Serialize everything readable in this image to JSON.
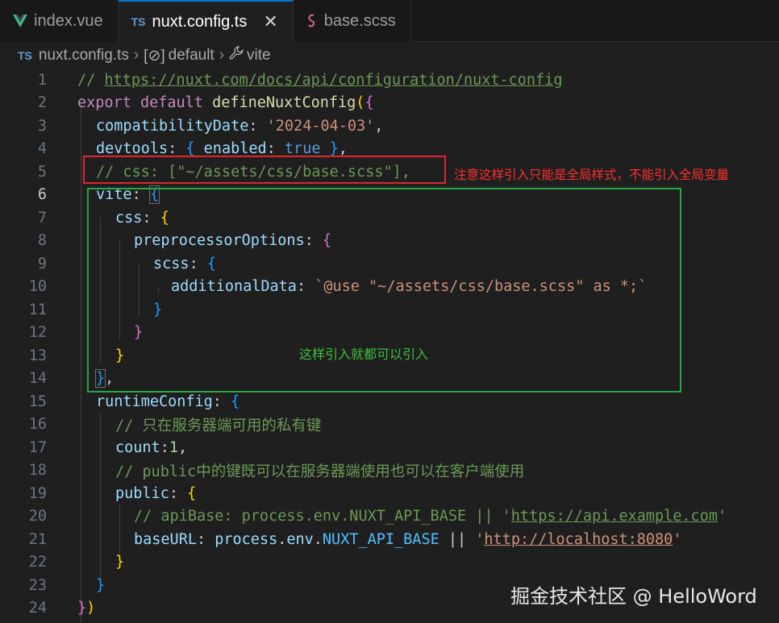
{
  "tabs": [
    {
      "label": "index.vue",
      "icon": "vue-icon"
    },
    {
      "label": "nuxt.config.ts",
      "icon": "typescript-icon",
      "prefix": "TS",
      "active": true,
      "close": "✕"
    },
    {
      "label": "base.scss",
      "icon": "scss-icon"
    }
  ],
  "breadcrumb": {
    "prefix": "TS",
    "file": "nuxt.config.ts",
    "sep": "›",
    "symbol": "default",
    "symbol_icon": "[⊘]",
    "last": "vite"
  },
  "line_numbers": [
    "1",
    "2",
    "3",
    "4",
    "5",
    "6",
    "7",
    "8",
    "9",
    "10",
    "11",
    "12",
    "13",
    "14",
    "15",
    "16",
    "17",
    "18",
    "19",
    "20",
    "21",
    "22",
    "23",
    "24"
  ],
  "code": {
    "l1": {
      "comment": "// ",
      "url": "https://nuxt.com/docs/api/configuration/nuxt-config"
    },
    "l2": {
      "kw1": "export",
      "kw2": "default",
      "fn": "defineNuxtConfig",
      "open": "(",
      "brace": "{"
    },
    "l3": {
      "prop": "compatibilityDate",
      "colon": ": ",
      "str": "'2024-04-03'",
      "comma": ","
    },
    "l4": {
      "prop": "devtools",
      "colon": ": ",
      "ob": "{",
      "prop2": " enabled",
      "colon2": ": ",
      "val": "true",
      "cb": " }",
      "comma": ","
    },
    "l5": {
      "comment": "// css: [\"~/assets/css/base.scss\"],"
    },
    "l6": {
      "prop": "vite",
      "colon": ": ",
      "brace": "{"
    },
    "l7": {
      "prop": "css",
      "colon": ": ",
      "brace": "{"
    },
    "l8": {
      "prop": "preprocessorOptions",
      "colon": ": ",
      "brace": "{"
    },
    "l9": {
      "prop": "scss",
      "colon": ": ",
      "brace": "{"
    },
    "l10": {
      "prop": "additionalData",
      "colon": ": ",
      "str": "`@use \"~/assets/css/base.scss\" as *;`"
    },
    "l11": {
      "brace": "}"
    },
    "l12": {
      "brace": "}"
    },
    "l13": {
      "brace": "}"
    },
    "l14": {
      "brace": "}",
      "comma": ","
    },
    "l15": {
      "prop": "runtimeConfig",
      "colon": ": ",
      "brace": "{"
    },
    "l16": {
      "comment": "// 只在服务器端可用的私有键"
    },
    "l17": {
      "prop": "count",
      "colon": ":",
      "num": "1",
      "comma": ","
    },
    "l18": {
      "comment": "// public中的键既可以在服务器端使用也可以在客户端使用"
    },
    "l19": {
      "prop": "public",
      "colon": ": ",
      "brace": "{"
    },
    "l20": {
      "comment": "// apiBase: process.env.NUXT_API_BASE || '",
      "url": "https://api.example.com",
      "tail": "'"
    },
    "l21": {
      "prop": "baseURL",
      "colon": ": ",
      "obj": "process",
      "dot1": ".",
      "obj2": "env",
      "dot2": ".",
      "const": "NUXT_API_BASE",
      "op": " || ",
      "q1": "'",
      "url": "http://localhost:8080",
      "q2": "'"
    },
    "l22": {
      "brace": "}"
    },
    "l23": {
      "brace": "}"
    },
    "l24": {
      "brace": "}",
      "paren": ")"
    }
  },
  "annotations": {
    "red_note": "注意这样引入只能是全局样式，不能引入全局变量",
    "green_note": "这样引入就都可以引入"
  },
  "watermark": "掘金技术社区 @ HelloWord",
  "colors": {
    "accent": "#0078d4",
    "red_box": "#e0262b",
    "green_box": "#28a745"
  }
}
